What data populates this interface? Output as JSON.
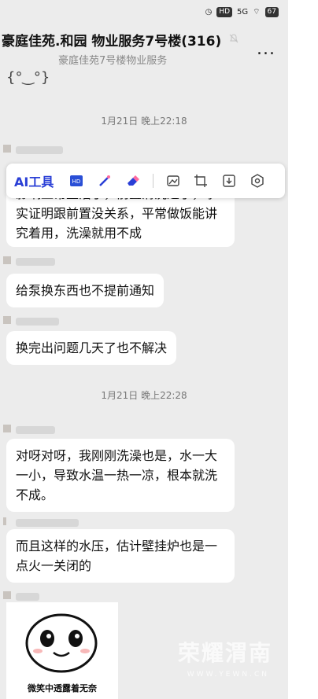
{
  "status_bar": {
    "network": "5G",
    "battery": "67"
  },
  "header": {
    "title": "豪庭佳苑.和园 物业服务7号楼(316)",
    "subtitle": "豪庭佳苑7号楼物业服务",
    "more_label": "..."
  },
  "toolbar": {
    "ai_label": "AI工具",
    "icons": [
      "hd-icon",
      "magic-wand-icon",
      "eraser-icon",
      "image-edit-icon",
      "crop-icon",
      "download-icon",
      "settings-icon"
    ]
  },
  "messages": {
    "time1": "1月21日 晚上22:18",
    "msg1": "影响正常生活了，前置清洗过了，事实证明跟前置没关系，平常做饭能讲究着用，洗澡就用不成",
    "msg2": "给泵换东西也不提前通知",
    "msg3": "换完出问题几天了也不解决",
    "time2": "1月21日 晚上22:28",
    "msg4": "对呀对呀，我刚刚洗澡也是，水一大一小，导致水温一热一凉，根本就洗不成。",
    "msg5": "而且这样的水压，估计壁挂炉也是一点火一关闭的"
  },
  "meme": {
    "caption": "微笑中透露着无奈"
  },
  "watermark": {
    "text": "荣耀渭南",
    "sub": "WWW.YEWN.CN"
  }
}
